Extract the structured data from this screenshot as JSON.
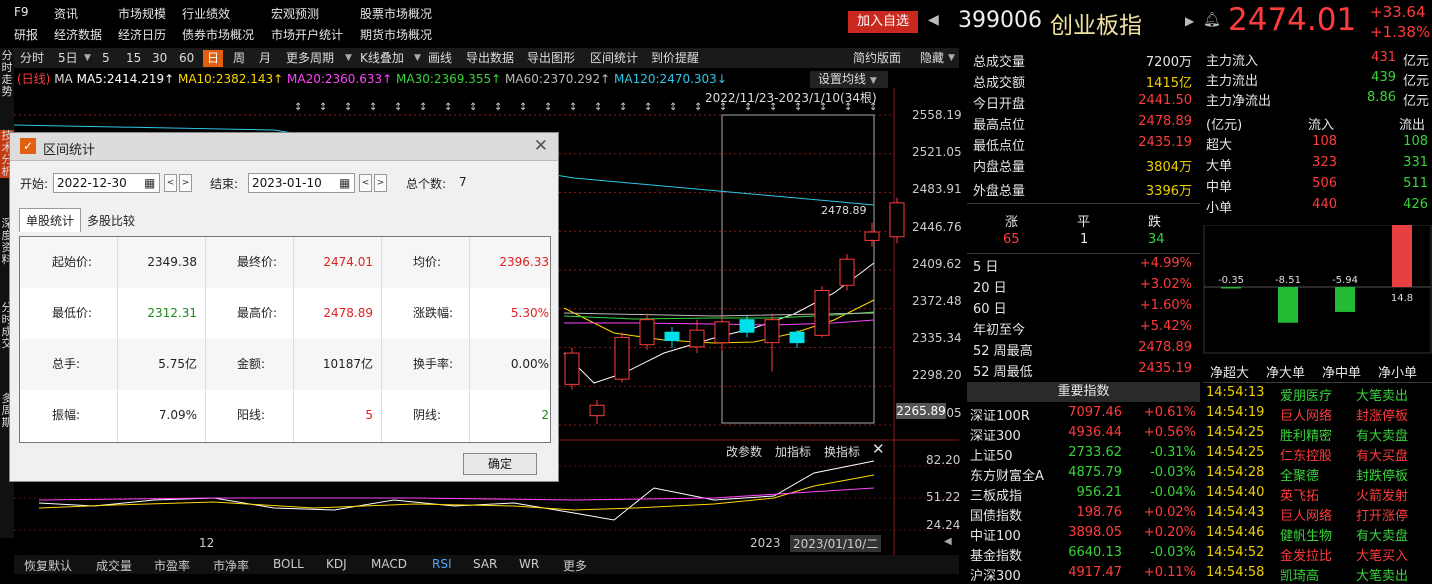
{
  "topmenu": {
    "r1": [
      "F9",
      "资讯",
      "市场规模",
      "行业绩效",
      "宏观预测",
      "股票市场概况"
    ],
    "r2": [
      "研报",
      "经济数据",
      "经济日历",
      "债券市场概况",
      "市场开户统计",
      "期货市场概况"
    ]
  },
  "header": {
    "add_fav": "加入自选",
    "code": "399006",
    "name": "创业板指",
    "price": "2474.01",
    "change": "+33.64",
    "pct": "+1.38%"
  },
  "toolbar": {
    "items": [
      "分时",
      "5日",
      "5",
      "15",
      "30",
      "60",
      "日",
      "周",
      "月",
      "更多周期",
      "K线叠加",
      "画线",
      "导出数据",
      "导出图形",
      "区间统计",
      "到价提醒"
    ],
    "right": [
      "简约版面",
      "隐藏"
    ]
  },
  "left_strip": [
    "分时走势",
    "技术分析",
    "深度资料",
    "分时成交",
    "多周期"
  ],
  "chart": {
    "ma_line": {
      "tag": "(日线)",
      "ma": "MA",
      "items": [
        {
          "label": "MA5:2414.219↑",
          "color": "#ffffff"
        },
        {
          "label": "MA10:2382.143↑",
          "color": "#ffd700"
        },
        {
          "label": "MA20:2360.633↑",
          "color": "#ff44ff"
        },
        {
          "label": "MA30:2369.355↑",
          "color": "#39d33a"
        },
        {
          "label": "MA60:2370.292↑",
          "color": "#bbbbbb"
        },
        {
          "label": "MA120:2470.303↓",
          "color": "#2ec7e8"
        }
      ]
    },
    "setting": "设置均线",
    "range_label": "2022/11/23-2023/1/10(34根)",
    "high_label": "2478.89",
    "price_ticks": [
      "2558.19",
      "2521.05",
      "2483.91",
      "2446.76",
      "2409.62",
      "2372.48",
      "2335.34",
      "2298.20",
      "2261.05"
    ],
    "cursor_price": "2265.89",
    "indicator": {
      "buttons": [
        "改参数",
        "加指标",
        "换指标"
      ],
      "ticks": [
        "82.20",
        "51.22",
        "24.24"
      ]
    },
    "x_labels": [
      "12",
      "2023",
      "2023/01/10/二"
    ]
  },
  "dialog": {
    "title": "区间统计",
    "start_label": "开始:",
    "start_date": "2022-12-30",
    "end_label": "结束:",
    "end_date": "2023-01-10",
    "count_label": "总个数:",
    "count": "7",
    "tabs": [
      "单股统计",
      "多股比较"
    ],
    "rows": [
      [
        {
          "l": "起始价:",
          "v": "2349.38",
          "c": ""
        },
        {
          "l": "最终价:",
          "v": "2474.01",
          "c": "red"
        },
        {
          "l": "均价:",
          "v": "2396.33",
          "c": "red"
        }
      ],
      [
        {
          "l": "最低价:",
          "v": "2312.31",
          "c": "grn"
        },
        {
          "l": "最高价:",
          "v": "2478.89",
          "c": "red"
        },
        {
          "l": "涨跌幅:",
          "v": "5.30%",
          "c": "red"
        }
      ],
      [
        {
          "l": "总手:",
          "v": "5.75亿",
          "c": ""
        },
        {
          "l": "金额:",
          "v": "10187亿",
          "c": ""
        },
        {
          "l": "换手率:",
          "v": "0.00%",
          "c": ""
        }
      ],
      [
        {
          "l": "振幅:",
          "v": "7.09%",
          "c": ""
        },
        {
          "l": "阳线:",
          "v": "5",
          "c": "red"
        },
        {
          "l": "阴线:",
          "v": "2",
          "c": "grn"
        }
      ]
    ],
    "ok": "确定"
  },
  "bottom_tabs": [
    "恢复默认",
    "成交量",
    "市盈率",
    "市净率",
    "BOLL",
    "KDJ",
    "MACD",
    "RSI",
    "SAR",
    "WR",
    "更多"
  ],
  "quote": {
    "rows": [
      {
        "l": "总成交量",
        "v": "7200万",
        "c": "#e6e6e6"
      },
      {
        "l": "总成交额",
        "v": "1415亿",
        "c": "#f0d000"
      },
      {
        "l": "今日开盘",
        "v": "2441.50",
        "c": "#ff3b3b"
      },
      {
        "l": "最高点位",
        "v": "2478.89",
        "c": "#ff3b3b"
      },
      {
        "l": "最低点位",
        "v": "2435.19",
        "c": "#ff3b3b"
      },
      {
        "l": "内盘总量",
        "v": "3804万",
        "c": "#f0d000"
      },
      {
        "l": "外盘总量",
        "v": "3396万",
        "c": "#f0d000"
      }
    ],
    "breadth": {
      "up": "涨",
      "flat": "平",
      "down": "跌",
      "up_n": "65",
      "flat_n": "1",
      "down_n": "34"
    },
    "perf": [
      {
        "l": "5 日",
        "v": "+4.99%"
      },
      {
        "l": "20 日",
        "v": "+3.02%"
      },
      {
        "l": "60 日",
        "v": "+1.60%"
      },
      {
        "l": "年初至今",
        "v": "+5.42%"
      },
      {
        "l": "52 周最高",
        "v": "2478.89"
      },
      {
        "l": "52 周最低",
        "v": "2435.19"
      }
    ],
    "idx_title": "重要指数",
    "indices": [
      {
        "n": "深证100R",
        "p": "7097.46",
        "c": "+0.61%",
        "col": "#ff3b3b"
      },
      {
        "n": "深证300",
        "p": "4936.44",
        "c": "+0.56%",
        "col": "#ff3b3b"
      },
      {
        "n": "上证50",
        "p": "2733.62",
        "c": "-0.31%",
        "col": "#39d33a"
      },
      {
        "n": "东方财富全A",
        "p": "4875.79",
        "c": "-0.03%",
        "col": "#39d33a"
      },
      {
        "n": "三板成指",
        "p": "956.21",
        "c": "-0.04%",
        "col": "#39d33a"
      },
      {
        "n": "国债指数",
        "p": "198.76",
        "c": "+0.02%",
        "col": "#ff3b3b"
      },
      {
        "n": "中证100",
        "p": "3898.05",
        "c": "+0.20%",
        "col": "#ff3b3b"
      },
      {
        "n": "基金指数",
        "p": "6640.13",
        "c": "-0.03%",
        "col": "#39d33a"
      },
      {
        "n": "沪深300",
        "p": "4917.47",
        "c": "+0.11%",
        "col": "#ff3b3b"
      }
    ]
  },
  "flow": {
    "rows": [
      {
        "l": "主力流入",
        "v": "431",
        "c": "#ff3b3b",
        "u": "亿元"
      },
      {
        "l": "主力流出",
        "v": "439",
        "c": "#39d33a",
        "u": "亿元"
      },
      {
        "l": "主力净流出",
        "v": "8.86",
        "c": "#39d33a",
        "u": "亿元"
      }
    ],
    "hdr": [
      "(亿元)",
      "流入",
      "流出"
    ],
    "sizes": [
      {
        "l": "超大",
        "in": "108",
        "out": "108"
      },
      {
        "l": "大单",
        "in": "323",
        "out": "331"
      },
      {
        "l": "中单",
        "in": "506",
        "out": "511"
      },
      {
        "l": "小单",
        "in": "440",
        "out": "426"
      }
    ],
    "bars": [
      {
        "label": "-0.35",
        "value": -0.35
      },
      {
        "label": "-8.51",
        "value": -8.51
      },
      {
        "label": "-5.94",
        "value": -5.94
      },
      {
        "label": "14.8",
        "value": 14.8
      }
    ],
    "bar_names": [
      "净超大",
      "净大单",
      "净中单",
      "净小单"
    ],
    "ticks": [
      {
        "t": "14:54:13",
        "s": "爱朋医疗",
        "e": "大笔卖出",
        "c": "#39d33a"
      },
      {
        "t": "14:54:19",
        "s": "巨人网络",
        "e": "封涨停板",
        "c": "#ff3b3b"
      },
      {
        "t": "14:54:25",
        "s": "胜利精密",
        "e": "有大卖盘",
        "c": "#39d33a"
      },
      {
        "t": "14:54:25",
        "s": "仁东控股",
        "e": "有大买盘",
        "c": "#ff3b3b"
      },
      {
        "t": "14:54:28",
        "s": "全聚德",
        "e": "封跌停板",
        "c": "#39d33a"
      },
      {
        "t": "14:54:40",
        "s": "英飞拓",
        "e": "火箭发射",
        "c": "#ff3b3b"
      },
      {
        "t": "14:54:43",
        "s": "巨人网络",
        "e": "打开涨停",
        "c": "#ff3b3b"
      },
      {
        "t": "14:54:46",
        "s": "健帆生物",
        "e": "有大卖盘",
        "c": "#39d33a"
      },
      {
        "t": "14:54:52",
        "s": "金发拉比",
        "e": "大笔买入",
        "c": "#ff3b3b"
      },
      {
        "t": "14:54:58",
        "s": "凯琦高",
        "e": "大笔卖出",
        "c": "#39d33a"
      }
    ]
  },
  "candles": [
    {
      "o": 2300.0,
      "c": 2330.0,
      "h": 2335.0,
      "l": 2295.0
    },
    {
      "o": 2270.0,
      "c": 2280.0,
      "h": 2285.0,
      "l": 2262.0
    },
    {
      "o": 2305.0,
      "c": 2345.0,
      "h": 2350.0,
      "l": 2302.0
    },
    {
      "o": 2338.0,
      "c": 2362.0,
      "h": 2368.0,
      "l": 2333.0
    },
    {
      "o": 2350.0,
      "c": 2342.0,
      "h": 2355.0,
      "l": 2335.0
    },
    {
      "o": 2336.0,
      "c": 2352.0,
      "h": 2362.0,
      "l": 2330.0
    },
    {
      "o": 2340.0,
      "c": 2360.0,
      "h": 2365.0,
      "l": 2332.0
    },
    {
      "o": 2362.0,
      "c": 2350.0,
      "h": 2366.0,
      "l": 2345.0
    },
    {
      "o": 2340.0,
      "c": 2362.0,
      "h": 2368.0,
      "l": 2312.3
    },
    {
      "o": 2350.0,
      "c": 2340.0,
      "h": 2352.0,
      "l": 2335.0
    },
    {
      "o": 2347.0,
      "c": 2390.0,
      "h": 2394.0,
      "l": 2345.0
    },
    {
      "o": 2395.0,
      "c": 2420.0,
      "h": 2425.0,
      "l": 2390.0
    },
    {
      "o": 2438.0,
      "c": 2446.0,
      "h": 2455.0,
      "l": 2432.0
    },
    {
      "o": 2441.5,
      "c": 2474.0,
      "h": 2478.9,
      "l": 2435.2
    }
  ]
}
